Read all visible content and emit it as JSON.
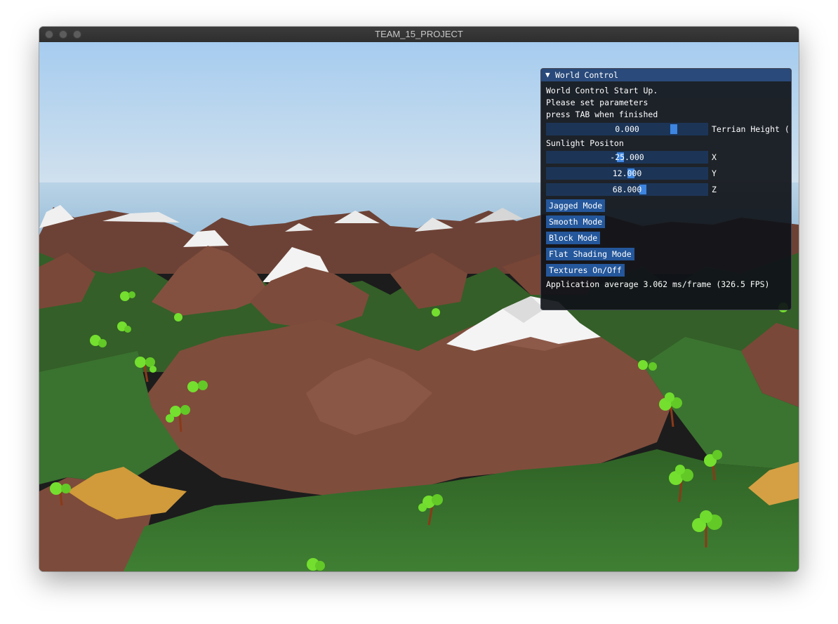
{
  "window": {
    "title": "TEAM_15_PROJECT",
    "traffic_lights": [
      "close",
      "minimize",
      "zoom"
    ]
  },
  "scene": {
    "description_icon": "terrain-3d-render",
    "colors": {
      "sky_top": "#a8cdf0",
      "sky_horizon": "#dfe9f1",
      "grass": "#3f7a32",
      "rock": "#7a4a3a",
      "snow": "#f2f2f2",
      "sand": "#d19a3a",
      "tree_leaves": "#6fdc2e",
      "tree_trunk": "#8a3a18"
    }
  },
  "panel": {
    "title": "World Control",
    "collapse_icon": "triangle-down-icon",
    "intro_lines": [
      "World Control Start Up.",
      "Please set parameters",
      "press TAB when finished"
    ],
    "terrain_height": {
      "value": "0.000",
      "label": "Terrian Height (",
      "fraction": 0.8
    },
    "sunlight_label": "Sunlight Positon",
    "sun_x": {
      "value": "-25.000",
      "label": "X",
      "fraction": 0.45
    },
    "sun_y": {
      "value": "12.000",
      "label": "Y",
      "fraction": 0.52
    },
    "sun_z": {
      "value": "68.000",
      "label": "Z",
      "fraction": 0.6
    },
    "buttons": {
      "jagged": "Jagged Mode",
      "smooth": "Smooth Mode",
      "block": "Block Mode",
      "flat": "Flat Shading Mode",
      "textures": "Textures On/Off"
    },
    "stats": "Application average 3.062 ms/frame (326.5 FPS)",
    "accent": "#3d85e0"
  }
}
